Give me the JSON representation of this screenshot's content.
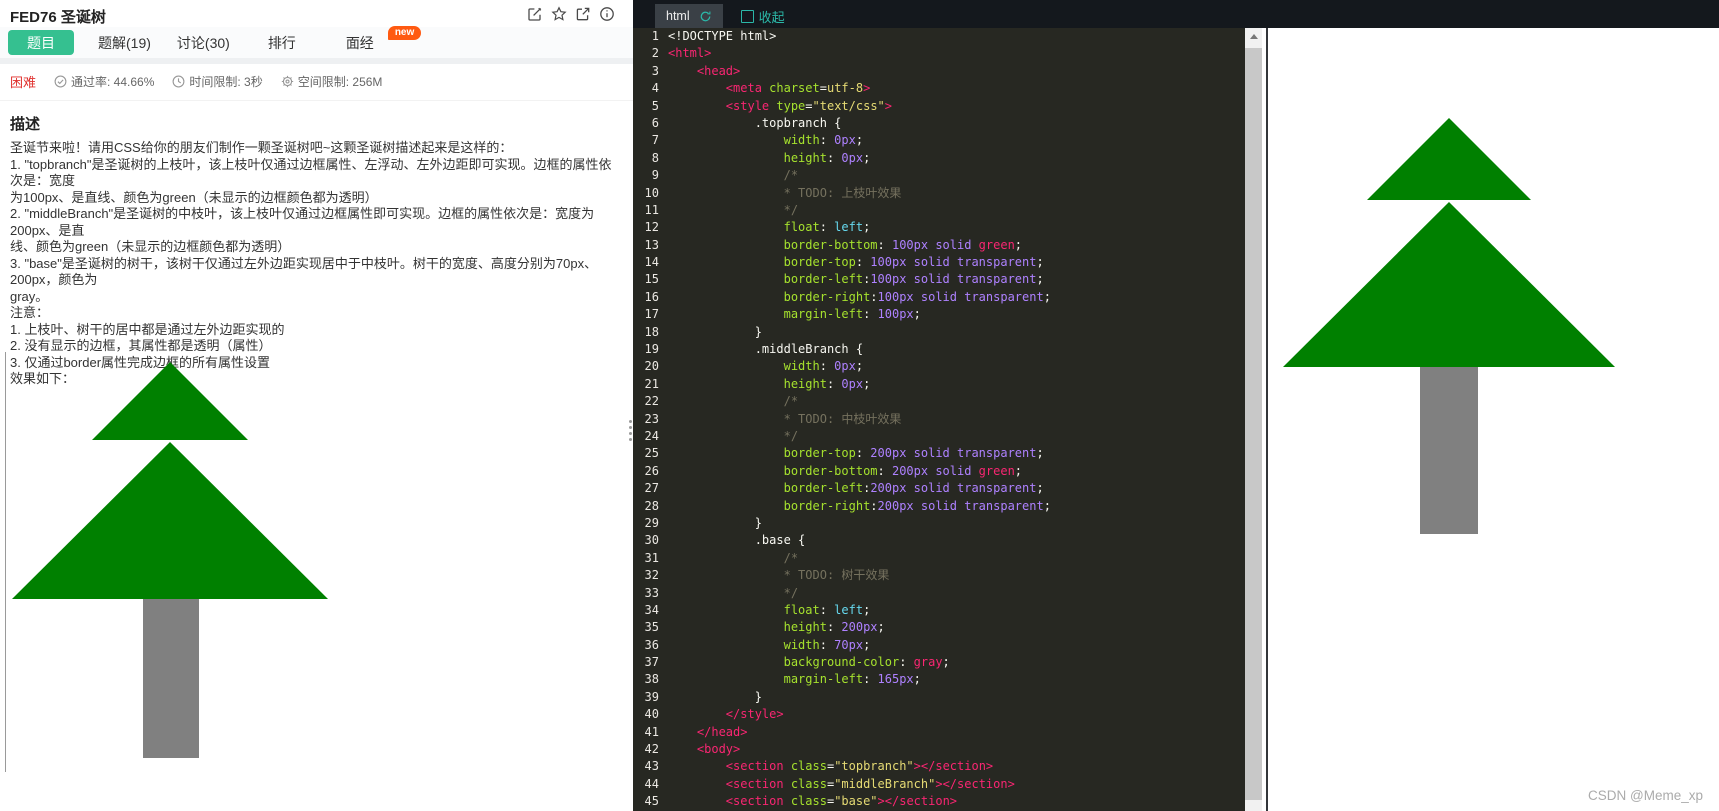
{
  "problem": {
    "title": "FED76 圣诞树",
    "tabs": [
      {
        "label": "题目",
        "active": true
      },
      {
        "label": "题解(19)",
        "active": false
      },
      {
        "label": "讨论(30)",
        "active": false
      },
      {
        "label": "排行",
        "active": false
      },
      {
        "label": "面经",
        "active": false
      }
    ],
    "new_badge": "new",
    "meta": {
      "difficulty": "困难",
      "pass_rate": "通过率: 44.66%",
      "time_limit": "时间限制: 3秒",
      "memory_limit": "空间限制: 256M"
    },
    "description_heading": "描述",
    "description_lines": [
      "圣诞节来啦！请用CSS给你的朋友们制作一颗圣诞树吧~这颗圣诞树描述起来是这样的：",
      "1. \"topbranch\"是圣诞树的上枝叶，该上枝叶仅通过边框属性、左浮动、左外边距即可实现。边框的属性依次是：宽度",
      "为100px、是直线、颜色为green（未显示的边框颜色都为透明）",
      "2. \"middleBranch\"是圣诞树的中枝叶，该上枝叶仅通过边框属性即可实现。边框的属性依次是：宽度为200px、是直",
      "线、颜色为green（未显示的边框颜色都为透明）",
      "3. \"base\"是圣诞树的树干，该树干仅通过左外边距实现居中于中枝叶。树干的宽度、高度分别为70px、200px，颜色为",
      "gray。",
      "注意：",
      "1. 上枝叶、树干的居中都是通过左外边距实现的",
      "2. 没有显示的边框，其属性都是透明（属性）",
      "3. 仅通过border属性完成边框的所有属性设置",
      "效果如下："
    ]
  },
  "editor": {
    "tab_label": "html",
    "collapse_label": "收起",
    "icons": [
      "refresh-icon",
      "collapse-icon"
    ],
    "code_lines": [
      [
        [
          "pln",
          "<!DOCTYPE html>"
        ]
      ],
      [
        [
          "tag",
          "<html>"
        ]
      ],
      [
        [
          "pln",
          "    "
        ],
        [
          "tag",
          "<head>"
        ]
      ],
      [
        [
          "pln",
          "        "
        ],
        [
          "tag",
          "<meta "
        ],
        [
          "atn",
          "charset"
        ],
        [
          "pln",
          "="
        ],
        [
          "str",
          "utf-8"
        ],
        [
          "tag",
          ">"
        ]
      ],
      [
        [
          "pln",
          "        "
        ],
        [
          "tag",
          "<style "
        ],
        [
          "atn",
          "type"
        ],
        [
          "pln",
          "="
        ],
        [
          "str",
          "\"text/css\""
        ],
        [
          "tag",
          ">"
        ]
      ],
      [
        [
          "pln",
          "            .topbranch {"
        ]
      ],
      [
        [
          "pln",
          "                "
        ],
        [
          "prp",
          "width"
        ],
        [
          "pln",
          ": "
        ],
        [
          "num",
          "0px"
        ],
        [
          "pln",
          ";"
        ]
      ],
      [
        [
          "pln",
          "                "
        ],
        [
          "prp",
          "height"
        ],
        [
          "pln",
          ": "
        ],
        [
          "num",
          "0px"
        ],
        [
          "pln",
          ";"
        ]
      ],
      [
        [
          "pln",
          "                "
        ],
        [
          "cmt",
          "/*"
        ]
      ],
      [
        [
          "pln",
          "                "
        ],
        [
          "cmt",
          "* TODO: 上枝叶效果"
        ]
      ],
      [
        [
          "pln",
          "                "
        ],
        [
          "cmt",
          "*/"
        ]
      ],
      [
        [
          "pln",
          "                "
        ],
        [
          "prp",
          "float"
        ],
        [
          "pln",
          ": "
        ],
        [
          "kw",
          "left"
        ],
        [
          "pln",
          ";"
        ]
      ],
      [
        [
          "pln",
          "                "
        ],
        [
          "prp",
          "border-bottom"
        ],
        [
          "pln",
          ": "
        ],
        [
          "num",
          "100px solid "
        ],
        [
          "clr",
          "green"
        ],
        [
          "pln",
          ";"
        ]
      ],
      [
        [
          "pln",
          "                "
        ],
        [
          "prp",
          "border-top"
        ],
        [
          "pln",
          ": "
        ],
        [
          "num",
          "100px solid transparent"
        ],
        [
          "pln",
          ";"
        ]
      ],
      [
        [
          "pln",
          "                "
        ],
        [
          "prp",
          "border-left"
        ],
        [
          "pln",
          ":"
        ],
        [
          "num",
          "100px solid transparent"
        ],
        [
          "pln",
          ";"
        ]
      ],
      [
        [
          "pln",
          "                "
        ],
        [
          "prp",
          "border-right"
        ],
        [
          "pln",
          ":"
        ],
        [
          "num",
          "100px solid transparent"
        ],
        [
          "pln",
          ";"
        ]
      ],
      [
        [
          "pln",
          "                "
        ],
        [
          "prp",
          "margin-left"
        ],
        [
          "pln",
          ": "
        ],
        [
          "num",
          "100px"
        ],
        [
          "pln",
          ";"
        ]
      ],
      [
        [
          "pln",
          "            }"
        ]
      ],
      [
        [
          "pln",
          "            .middleBranch {"
        ]
      ],
      [
        [
          "pln",
          "                "
        ],
        [
          "prp",
          "width"
        ],
        [
          "pln",
          ": "
        ],
        [
          "num",
          "0px"
        ],
        [
          "pln",
          ";"
        ]
      ],
      [
        [
          "pln",
          "                "
        ],
        [
          "prp",
          "height"
        ],
        [
          "pln",
          ": "
        ],
        [
          "num",
          "0px"
        ],
        [
          "pln",
          ";"
        ]
      ],
      [
        [
          "pln",
          "                "
        ],
        [
          "cmt",
          "/*"
        ]
      ],
      [
        [
          "pln",
          "                "
        ],
        [
          "cmt",
          "* TODO: 中枝叶效果"
        ]
      ],
      [
        [
          "pln",
          "                "
        ],
        [
          "cmt",
          "*/"
        ]
      ],
      [
        [
          "pln",
          "                "
        ],
        [
          "prp",
          "border-top"
        ],
        [
          "pln",
          ": "
        ],
        [
          "num",
          "200px solid transparent"
        ],
        [
          "pln",
          ";"
        ]
      ],
      [
        [
          "pln",
          "                "
        ],
        [
          "prp",
          "border-bottom"
        ],
        [
          "pln",
          ": "
        ],
        [
          "num",
          "200px solid "
        ],
        [
          "clr",
          "green"
        ],
        [
          "pln",
          ";"
        ]
      ],
      [
        [
          "pln",
          "                "
        ],
        [
          "prp",
          "border-left"
        ],
        [
          "pln",
          ":"
        ],
        [
          "num",
          "200px solid transparent"
        ],
        [
          "pln",
          ";"
        ]
      ],
      [
        [
          "pln",
          "                "
        ],
        [
          "prp",
          "border-right"
        ],
        [
          "pln",
          ":"
        ],
        [
          "num",
          "200px solid transparent"
        ],
        [
          "pln",
          ";"
        ]
      ],
      [
        [
          "pln",
          "            }"
        ]
      ],
      [
        [
          "pln",
          "            .base {"
        ]
      ],
      [
        [
          "pln",
          "                "
        ],
        [
          "cmt",
          "/*"
        ]
      ],
      [
        [
          "pln",
          "                "
        ],
        [
          "cmt",
          "* TODO: 树干效果"
        ]
      ],
      [
        [
          "pln",
          "                "
        ],
        [
          "cmt",
          "*/"
        ]
      ],
      [
        [
          "pln",
          "                "
        ],
        [
          "prp",
          "float"
        ],
        [
          "pln",
          ": "
        ],
        [
          "kw",
          "left"
        ],
        [
          "pln",
          ";"
        ]
      ],
      [
        [
          "pln",
          "                "
        ],
        [
          "prp",
          "height"
        ],
        [
          "pln",
          ": "
        ],
        [
          "num",
          "200px"
        ],
        [
          "pln",
          ";"
        ]
      ],
      [
        [
          "pln",
          "                "
        ],
        [
          "prp",
          "width"
        ],
        [
          "pln",
          ": "
        ],
        [
          "num",
          "70px"
        ],
        [
          "pln",
          ";"
        ]
      ],
      [
        [
          "pln",
          "                "
        ],
        [
          "prp",
          "background-color"
        ],
        [
          "pln",
          ": "
        ],
        [
          "clr",
          "gray"
        ],
        [
          "pln",
          ";"
        ]
      ],
      [
        [
          "pln",
          "                "
        ],
        [
          "prp",
          "margin-left"
        ],
        [
          "pln",
          ": "
        ],
        [
          "num",
          "165px"
        ],
        [
          "pln",
          ";"
        ]
      ],
      [
        [
          "pln",
          "            }"
        ]
      ],
      [
        [
          "pln",
          "        "
        ],
        [
          "tag",
          "</style>"
        ]
      ],
      [
        [
          "pln",
          "    "
        ],
        [
          "tag",
          "</head>"
        ]
      ],
      [
        [
          "pln",
          "    "
        ],
        [
          "tag",
          "<body>"
        ]
      ],
      [
        [
          "pln",
          "        "
        ],
        [
          "tag",
          "<section "
        ],
        [
          "atn",
          "class"
        ],
        [
          "pln",
          "="
        ],
        [
          "str",
          "\"topbranch\""
        ],
        [
          "tag",
          "></section>"
        ]
      ],
      [
        [
          "pln",
          "        "
        ],
        [
          "tag",
          "<section "
        ],
        [
          "atn",
          "class"
        ],
        [
          "pln",
          "="
        ],
        [
          "str",
          "\"middleBranch\""
        ],
        [
          "tag",
          "></section>"
        ]
      ],
      [
        [
          "pln",
          "        "
        ],
        [
          "tag",
          "<section "
        ],
        [
          "atn",
          "class"
        ],
        [
          "pln",
          "="
        ],
        [
          "str",
          "\"base\""
        ],
        [
          "tag",
          "></section>"
        ]
      ]
    ]
  },
  "preview": {
    "watermark": "CSDN @Meme_xp"
  },
  "colors": {
    "accent_green": "#35c090",
    "badge_orange": "#ff5a11",
    "difficulty_red": "#e0302d",
    "tree_green": "#008000",
    "trunk_gray": "#808080",
    "editor_background": "#272822",
    "editor_bar": "#14181d",
    "editor_teal": "#2bb8a8",
    "code_tag": "#f92672",
    "code_property": "#a6e22e",
    "code_string": "#e6db74",
    "code_number": "#ae81ff",
    "code_comment": "#75715e"
  }
}
